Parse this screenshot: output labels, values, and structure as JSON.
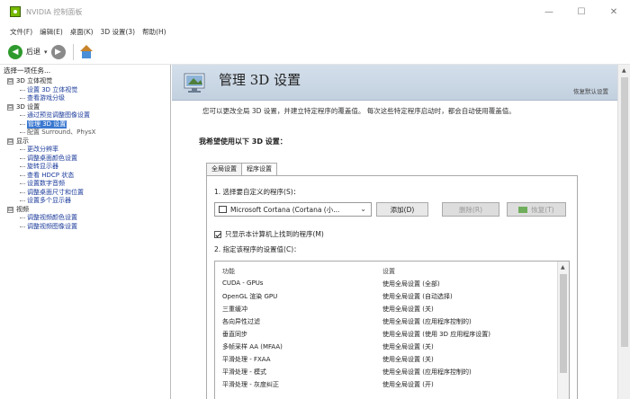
{
  "window": {
    "title": "NVIDIA 控制面板",
    "minimize": "—",
    "maximize": "☐",
    "close": "✕"
  },
  "menu": [
    "文件(F)",
    "编辑(E)",
    "桌面(K)",
    "3D 设置(3)",
    "帮助(H)"
  ],
  "toolbar": {
    "back_label": "后退",
    "dropdown_glyph": "▾"
  },
  "sidebar": {
    "header": "选择一项任务...",
    "groups": [
      {
        "label": "3D 设置",
        "toggle": "⊟",
        "items": [
          "通过预览调整图像设置",
          "管理 3D 设置",
          "配置 Surround、PhysX"
        ]
      },
      {
        "label": "显示",
        "toggle": "⊟",
        "items": [
          "更改分辨率",
          "调整桌面颜色设置",
          "旋转显示器",
          "查看 HDCP 状态",
          "设置数字音频",
          "调整桌面尺寸和位置",
          "设置多个显示器"
        ]
      },
      {
        "label": "视频",
        "toggle": "⊟",
        "items": [
          "调整视频颜色设置",
          "调整视频图像设置"
        ]
      }
    ],
    "top_group": {
      "label": "3D 立体视觉",
      "toggle": "⊟",
      "items": [
        "设置 3D 立体视觉",
        "查看游戏分级"
      ]
    }
  },
  "page": {
    "title": "管理 3D 设置",
    "restore_defaults": "恢复默认设置",
    "description": "您可以更改全局 3D 设置，并建立特定程序的覆盖值。 每次这些特定程序启动时，都会自动使用覆盖值。",
    "section_label": "我希望使用以下 3D 设置：",
    "tabs": [
      "全局设置",
      "程序设置"
    ],
    "active_tab": "程序设置",
    "step1": "1. 选择要自定义的程序(S)：",
    "program_selected": "Microsoft Cortana (Cortana (小...",
    "select_chevron": "⌄",
    "add_button": "添加(D)",
    "delete_button": "删除(R)",
    "restore_button": "恢复(T)",
    "checkbox_label": "只显示本计算机上找到的程序(M)",
    "step2": "2. 指定该程序的设置值(C)：",
    "table": {
      "headers": [
        "功能",
        "设置"
      ],
      "rows": [
        [
          "CUDA - GPUs",
          "使用全局设置 (全部)"
        ],
        [
          "OpenGL 渲染 GPU",
          "使用全局设置 (自动选择)"
        ],
        [
          "三重缓冲",
          "使用全局设置 (关)"
        ],
        [
          "各向异性过滤",
          "使用全局设置 (应用程序控制的)"
        ],
        [
          "垂直同步",
          "使用全局设置 (使用 3D 应用程序设置)"
        ],
        [
          "多帧采样 AA (MFAA)",
          "使用全局设置 (关)"
        ],
        [
          "平滑处理 - FXAA",
          "使用全局设置 (关)"
        ],
        [
          "平滑处理 - 模式",
          "使用全局设置 (应用程序控制的)"
        ],
        [
          "平滑处理 - 灰度纠正",
          "使用全局设置 (开)"
        ]
      ]
    },
    "scroll_up": "▲"
  }
}
